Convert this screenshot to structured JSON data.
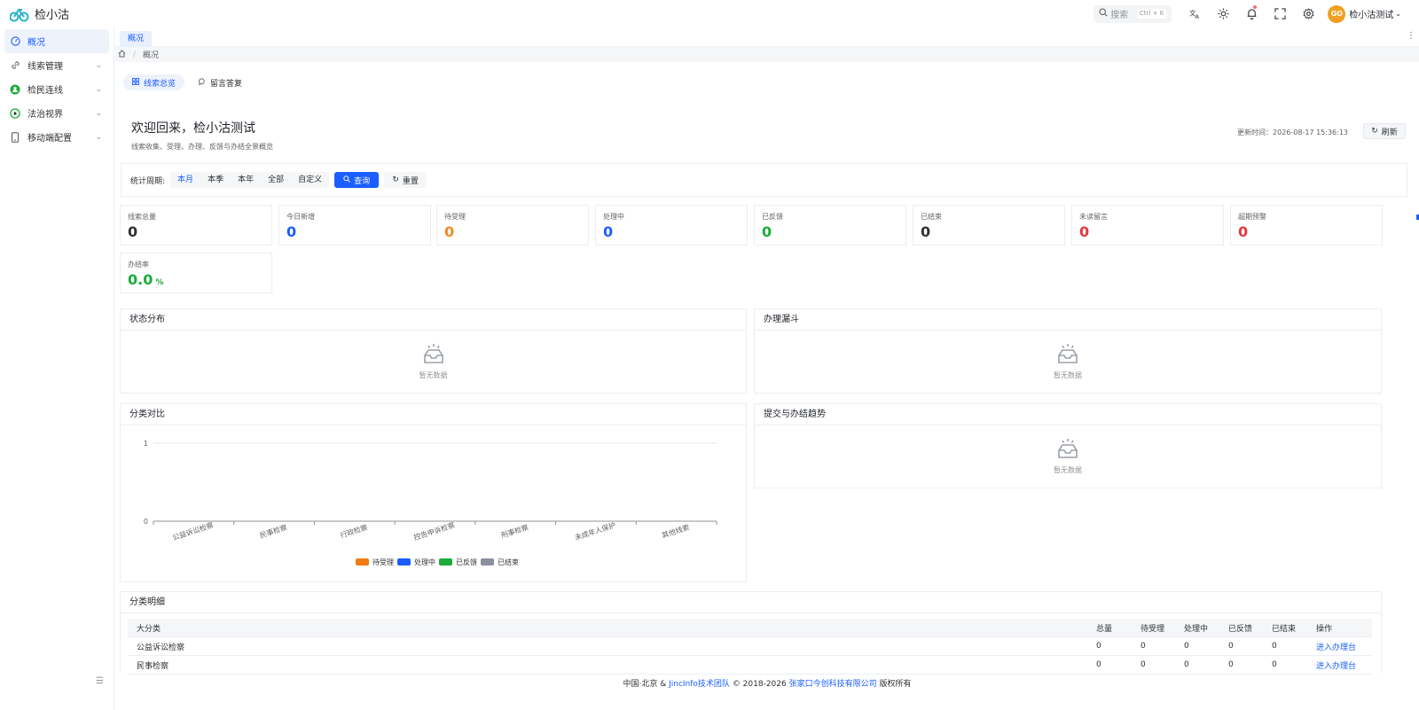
{
  "app": {
    "name": "检小沽"
  },
  "header": {
    "search_placeholder": "搜索",
    "search_shortcut": "Ctrl + K",
    "user_name": "检小沽测试",
    "avatar_text": "GO"
  },
  "sidebar": {
    "items": [
      {
        "label": "概况",
        "icon": "dashboard-icon",
        "active": true
      },
      {
        "label": "线索管理",
        "icon": "link-icon"
      },
      {
        "label": "检民连线",
        "icon": "people-icon"
      },
      {
        "label": "法治视界",
        "icon": "play-icon"
      },
      {
        "label": "移动端配置",
        "icon": "mobile-icon"
      }
    ]
  },
  "tabs": {
    "active": "概况"
  },
  "breadcrumb": {
    "current": "概况"
  },
  "segments": {
    "overview": "线索总览",
    "reply": "留言答复"
  },
  "welcome": {
    "title": "欢迎回来，检小沽测试",
    "subtitle": "线索收集、受理、办理、反馈与办结全景概览"
  },
  "update": {
    "label": "更新时间：",
    "time": "2026-08-17 15:36:13",
    "refresh": "刷新"
  },
  "filter": {
    "label": "统计周期:",
    "periods": [
      "本月",
      "本季",
      "本年",
      "全部",
      "自定义"
    ],
    "query": "查询",
    "reset": "重置"
  },
  "stats": [
    {
      "label": "线索总量",
      "value": "0",
      "color": "#303133"
    },
    {
      "label": "今日新增",
      "value": "0",
      "color": "#1a5eff"
    },
    {
      "label": "待受理",
      "value": "0",
      "color": "#f08a24"
    },
    {
      "label": "处理中",
      "value": "0",
      "color": "#1a5eff"
    },
    {
      "label": "已反馈",
      "value": "0",
      "color": "#1aad3a"
    },
    {
      "label": "已结束",
      "value": "0",
      "color": "#303133"
    },
    {
      "label": "未读留言",
      "value": "0",
      "color": "#e5363d"
    },
    {
      "label": "超期预警",
      "value": "0",
      "color": "#e5363d"
    },
    {
      "label": "办结率",
      "value": "0.0",
      "unit": "%",
      "color": "#1aad3a"
    }
  ],
  "panels": {
    "status": "状态分布",
    "funnel": "办理漏斗",
    "category": "分类对比",
    "trend": "提交与办结趋势",
    "detail": "分类明细",
    "empty_text": "暂无数据"
  },
  "chart_data": {
    "type": "bar",
    "categories": [
      "公益诉讼检察",
      "民事检察",
      "行政检察",
      "控告申诉检察",
      "刑事检察",
      "未成年人保护",
      "其他线索"
    ],
    "series": [
      {
        "name": "待受理",
        "values": [
          0,
          0,
          0,
          0,
          0,
          0,
          0
        ],
        "color": "#f07c12"
      },
      {
        "name": "处理中",
        "values": [
          0,
          0,
          0,
          0,
          0,
          0,
          0
        ],
        "color": "#1a5eff"
      },
      {
        "name": "已反馈",
        "values": [
          0,
          0,
          0,
          0,
          0,
          0,
          0
        ],
        "color": "#1aad3a"
      },
      {
        "name": "已结束",
        "values": [
          0,
          0,
          0,
          0,
          0,
          0,
          0
        ],
        "color": "#8a909c"
      }
    ],
    "ylim": [
      0,
      1
    ],
    "yticks": [
      "0",
      "1"
    ],
    "legend": "bottom"
  },
  "table": {
    "headers": [
      "大分类",
      "总量",
      "待受理",
      "处理中",
      "已反馈",
      "已结束",
      "操作"
    ],
    "rows": [
      {
        "name": "公益诉讼检察",
        "cells": [
          "0",
          "0",
          "0",
          "0",
          "0"
        ],
        "action": "进入办理台"
      },
      {
        "name": "民事检察",
        "cells": [
          "0",
          "0",
          "0",
          "0",
          "0"
        ],
        "action": "进入办理台"
      }
    ]
  },
  "footer": {
    "prefix": "中国·北京 &",
    "team": "JincInfo技术团队",
    "copy": "© 2018-2026",
    "company": "张家口今创科技有限公司",
    "suffix": "版权所有"
  }
}
